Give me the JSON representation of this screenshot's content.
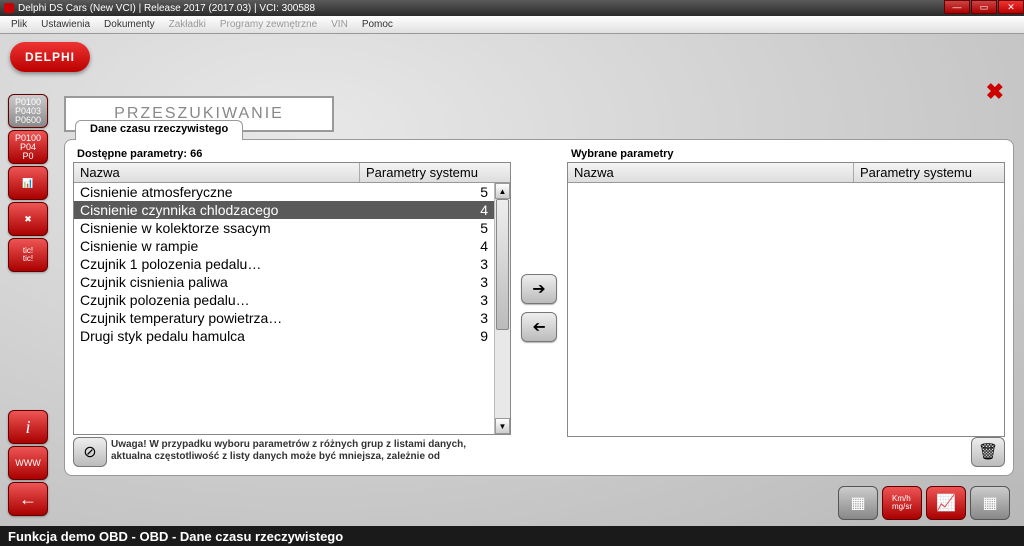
{
  "title": "Delphi DS Cars (New VCI) | Release 2017 (2017.03) | VCI: 300588",
  "menu": [
    "Plik",
    "Ustawienia",
    "Dokumenty",
    "Zakładki",
    "Programy zewnętrzne",
    "VIN",
    "Pomoc"
  ],
  "menu_disabled": [
    3,
    4,
    5
  ],
  "logo": "DELPHI",
  "header": "PRZESZUKIWANIE",
  "tab": "Dane czasu rzeczywistego",
  "left": {
    "title": "Dostępne parametry: 66",
    "cols": [
      "Nazwa",
      "Parametry systemu"
    ],
    "rows": [
      {
        "n": "Cisnienie atmosferyczne",
        "v": "5"
      },
      {
        "n": "Cisnienie czynnika chlodzacego",
        "v": "4",
        "sel": true
      },
      {
        "n": "Cisnienie w kolektorze ssacym",
        "v": "5"
      },
      {
        "n": "Cisnienie w rampie",
        "v": "4"
      },
      {
        "n": "Czujnik 1 polozenia pedalu…",
        "v": "3"
      },
      {
        "n": "Czujnik cisnienia paliwa",
        "v": "3"
      },
      {
        "n": "Czujnik polozenia pedalu…",
        "v": "3"
      },
      {
        "n": "Czujnik temperatury powietrza…",
        "v": "3"
      },
      {
        "n": "Drugi styk pedalu hamulca",
        "v": "9"
      }
    ]
  },
  "right": {
    "title": "Wybrane parametry",
    "cols": [
      "Nazwa",
      "Parametry systemu"
    ],
    "rows": []
  },
  "warning": "Uwaga!  W przypadku wyboru parametrów z różnych grup z listami danych, aktualna częstotliwość z listy danych może być mniejsza, zależnie od",
  "status": "Funkcja demo OBD - OBD - Dane czasu rzeczywistego",
  "side_codes_1": [
    "P0100",
    "P0403",
    "P0600"
  ],
  "side_codes_2": [
    "P0100",
    "P04",
    "P0"
  ]
}
